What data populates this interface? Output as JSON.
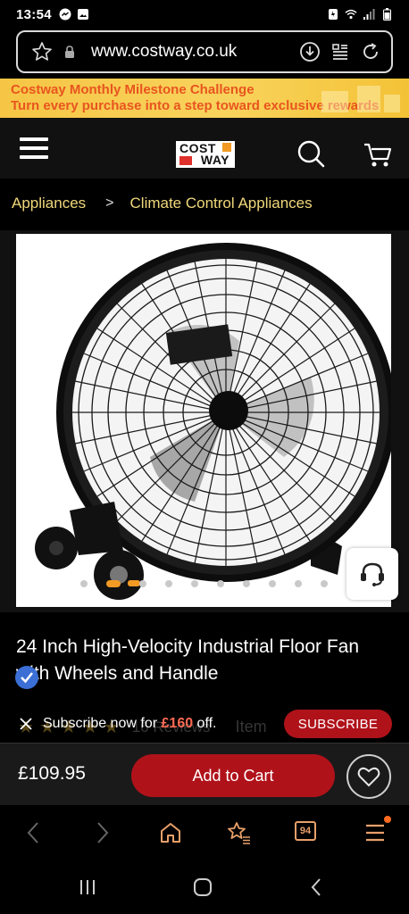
{
  "status_bar": {
    "time": "13:54"
  },
  "browser": {
    "url": "www.costway.co.uk",
    "tab_count": "94"
  },
  "promo": {
    "line1": "Costway Monthly Milestone Challenge",
    "line2": "Turn every purchase into a step toward exclusive rewards"
  },
  "header": {
    "logo_line1": "COST",
    "logo_line2": "WAY"
  },
  "breadcrumb": {
    "items": [
      "Appliances",
      "Climate Control Appliances"
    ],
    "separator": ">"
  },
  "gallery": {
    "dot_count": 10,
    "active_index": 1
  },
  "product": {
    "title_line1": "24 Inch High-Velocity Industrial Floor Fan",
    "title_line2": "with Wheels and Handle",
    "rating_stars": 5,
    "reviews": "16 Reviews",
    "item_label": "Item"
  },
  "subscribe": {
    "text_prefix": "Subscribe now for ",
    "amount": "£160",
    "text_suffix": " off.",
    "button": "SUBSCRIBE"
  },
  "purchase": {
    "price": "£109.95",
    "add_to_cart": "Add to Cart"
  },
  "colors": {
    "accent_red": "#b0121a",
    "breadcrumb_yellow": "#f0d87a",
    "promo_orange": "#e8551f",
    "logo_orange": "#f29a24"
  }
}
